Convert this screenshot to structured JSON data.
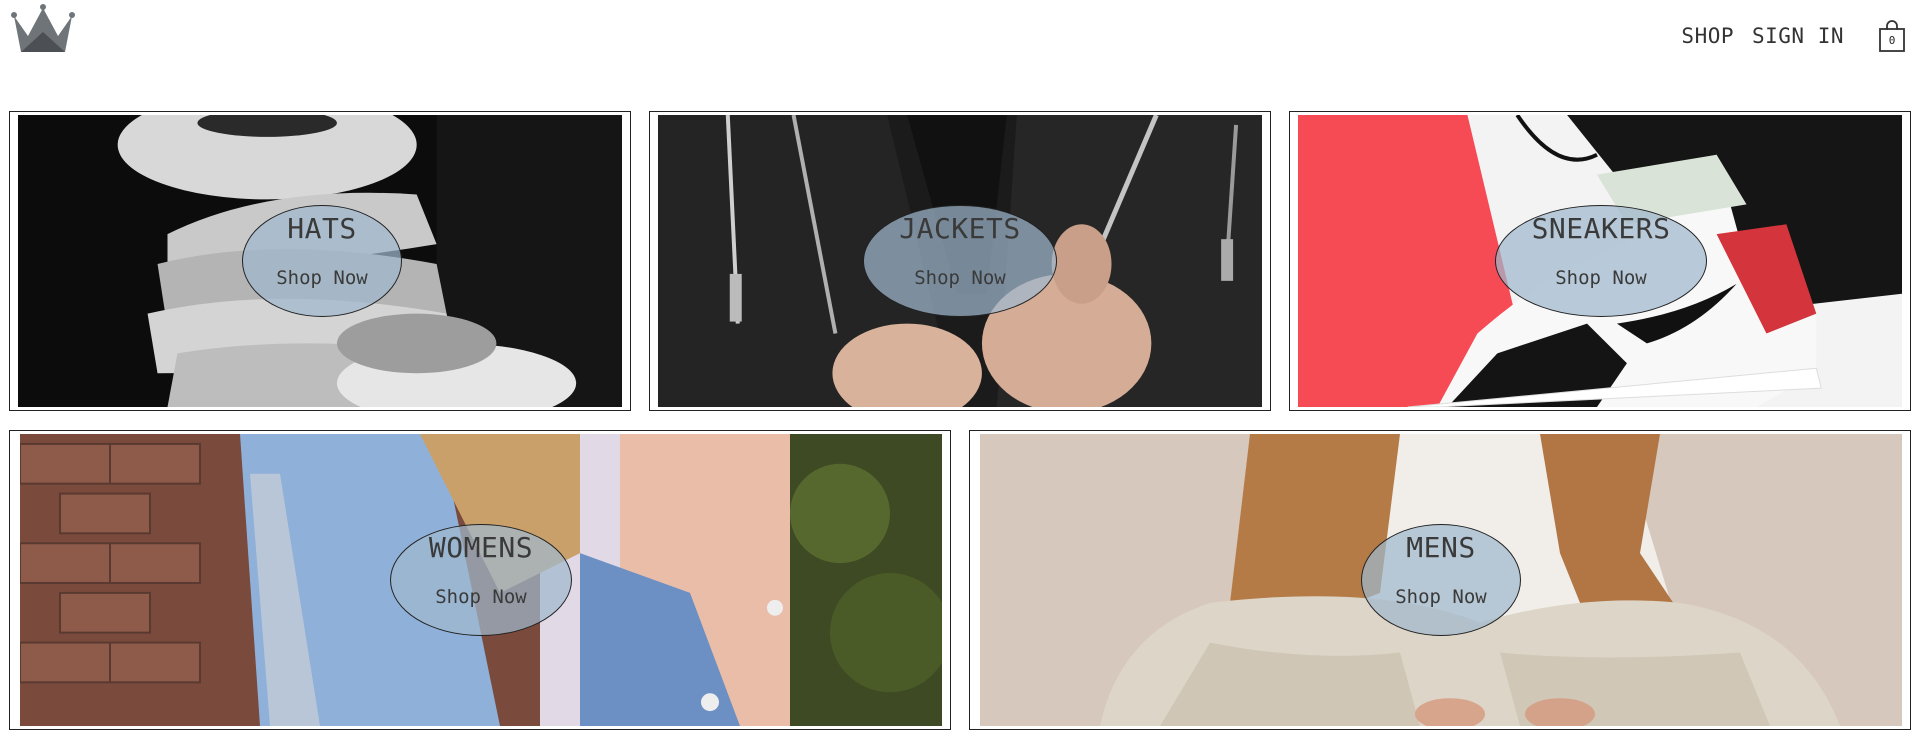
{
  "header": {
    "logo_icon": "crown-icon",
    "nav": {
      "shop_label": "SHOP",
      "signin_label": "SIGN IN"
    },
    "cart": {
      "icon": "shopping-bag-icon",
      "count": "0"
    }
  },
  "categories": [
    {
      "title": "HATS",
      "cta": "Shop Now",
      "image": "stacked-cowboy-hats-bw"
    },
    {
      "title": "JACKETS",
      "cta": "Shop Now",
      "image": "black-leather-jacket"
    },
    {
      "title": "SNEAKERS",
      "cta": "Shop Now",
      "image": "high-top-sneaker-red"
    },
    {
      "title": "WOMENS",
      "cta": "Shop Now",
      "image": "denim-jacket-woman"
    },
    {
      "title": "MENS",
      "cta": "Shop Now",
      "image": "man-tan-blazer-sitting"
    }
  ],
  "colors": {
    "bubble_fill": "#a0b9cd",
    "border": "#222222",
    "text": "#333333"
  }
}
